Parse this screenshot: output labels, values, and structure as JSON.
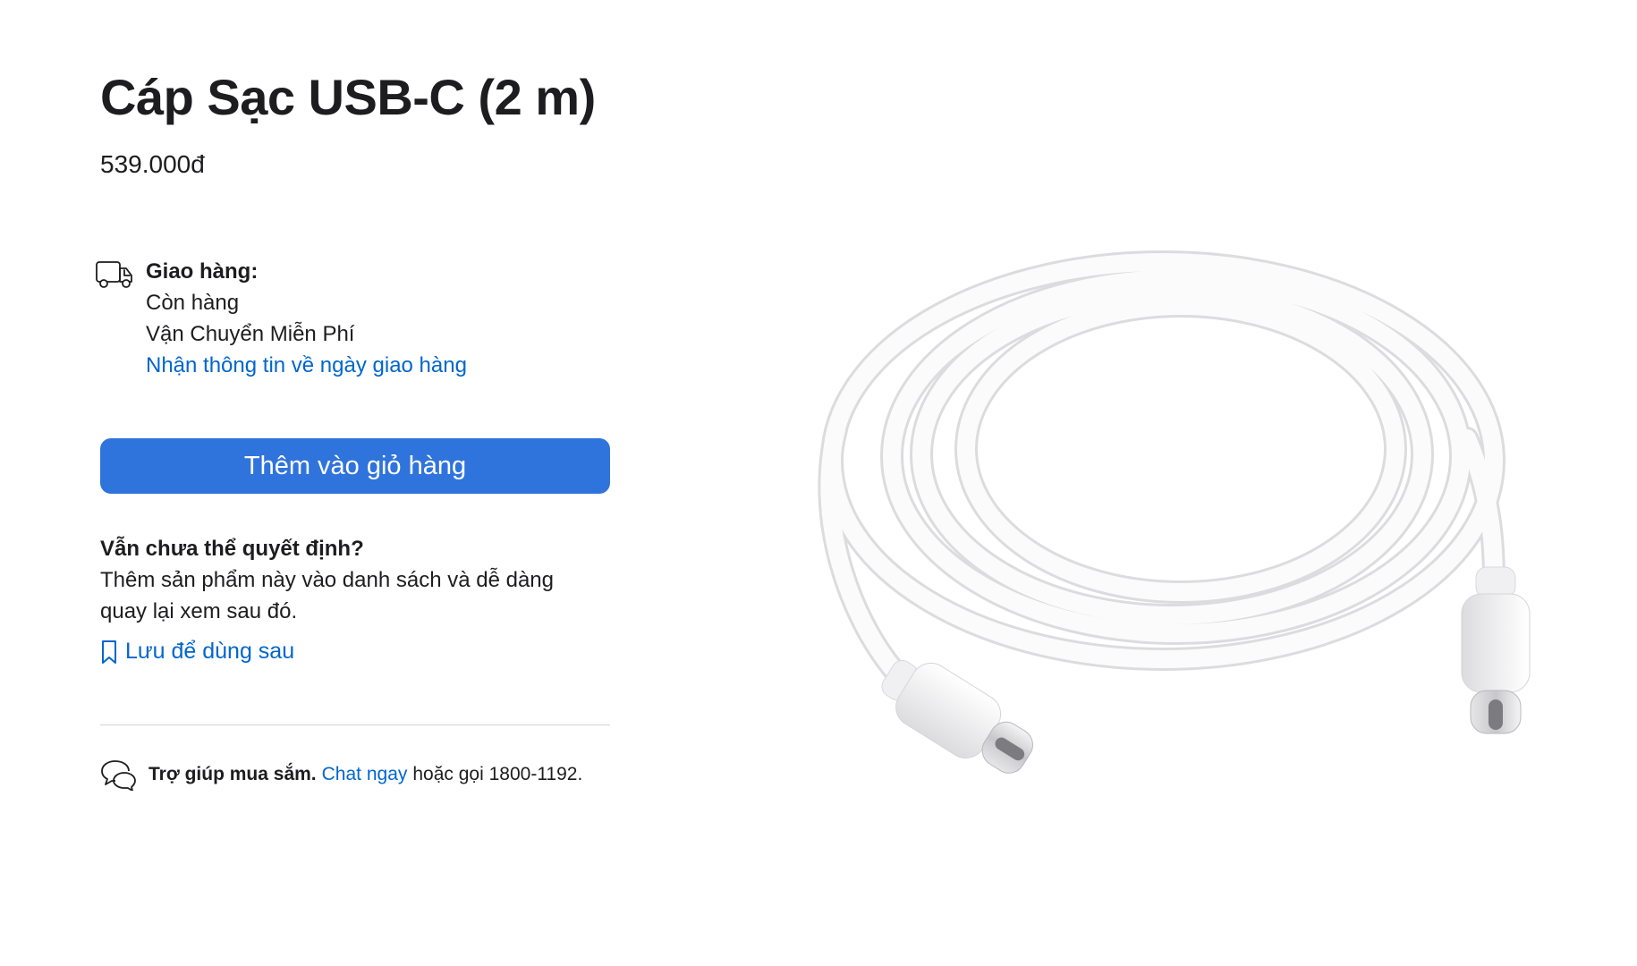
{
  "product": {
    "title": "Cáp Sạc USB-C (2 m)",
    "price": "539.000đ"
  },
  "delivery": {
    "icon": "truck-icon",
    "heading": "Giao hàng:",
    "stock": "Còn hàng",
    "shipping": "Vận Chuyển Miễn Phí",
    "date_link": "Nhận thông tin về ngày giao hàng"
  },
  "add_to_bag_label": "Thêm vào giỏ hàng",
  "undecided": {
    "heading": "Vẫn chưa thể quyết định?",
    "line1": "Thêm sản phẩm này vào danh sách và dễ dàng",
    "line2": "quay lại xem sau đó.",
    "save_label": "Lưu để dùng sau",
    "save_icon": "bookmark-icon"
  },
  "help": {
    "icon": "chat-bubbles-icon",
    "bold": "Trợ giúp mua sắm.",
    "chat_link": "Chat ngay",
    "rest": "hoặc gọi 1800-1192."
  },
  "colors": {
    "accent": "#0066cc",
    "button": "#2f74dc",
    "text": "#1d1d1f",
    "divider": "#d2d2d7"
  }
}
